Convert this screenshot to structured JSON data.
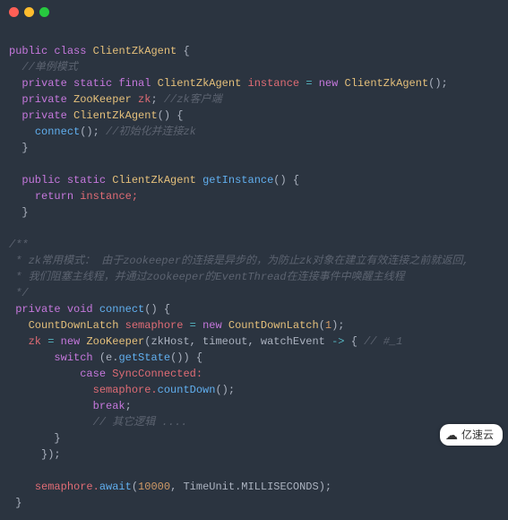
{
  "titlebar": {
    "dots": [
      "red",
      "yellow",
      "green"
    ]
  },
  "watermark": {
    "icon": "☁",
    "label": "亿速云"
  },
  "code": {
    "l1": {
      "a": "public",
      "b": "class",
      "c": "ClientZkAgent",
      "d": "{"
    },
    "l2": {
      "a": "//单例模式"
    },
    "l3": {
      "a": "private",
      "b": "static",
      "c": "final",
      "d": "ClientZkAgent",
      "e": "instance",
      "f": "=",
      "g": "new",
      "h": "ClientZkAgent",
      "i": "();"
    },
    "l4": {
      "a": "private",
      "b": "ZooKeeper",
      "c": "zk",
      "d": ";",
      "e": "//zk客户端"
    },
    "l5": {
      "a": "private",
      "b": "ClientZkAgent",
      "c": "() {"
    },
    "l6": {
      "a": "connect",
      "b": "();",
      "c": "//初始化并连接zk"
    },
    "l7": {
      "a": "}"
    },
    "l9": {
      "a": "public",
      "b": "static",
      "c": "ClientZkAgent",
      "d": "getInstance",
      "e": "() {"
    },
    "l10": {
      "a": "return",
      "b": "instance;"
    },
    "l11": {
      "a": "}"
    },
    "l13": {
      "a": "/**"
    },
    "l14": {
      "a": " * zk常用模式： 由于zookeeper的连接是异步的，为防止zk对象在建立有效连接之前就返回,"
    },
    "l15": {
      "a": " * 我们阻塞主线程，并通过zookeeper的EventThread在连接事件中唤醒主线程"
    },
    "l16": {
      "a": " */"
    },
    "l17": {
      "a": "private",
      "b": "void",
      "c": "connect",
      "d": "() {"
    },
    "l18": {
      "a": "CountDownLatch",
      "b": "semaphore",
      "c": "=",
      "d": "new",
      "e": "CountDownLatch",
      "f": "(",
      "g": "1",
      "h": ");"
    },
    "l19": {
      "a": "zk",
      "b": "=",
      "c": "new",
      "d": "ZooKeeper",
      "e": "(zkHost, timeout, watchEvent",
      "f": "->",
      "g": "{",
      "h": "// #_1"
    },
    "l20": {
      "a": "switch",
      "b": "(e.",
      "c": "getState",
      "d": "()) {"
    },
    "l21": {
      "a": "case",
      "b": "SyncConnected:"
    },
    "l22": {
      "a": "semaphore.",
      "b": "countDown",
      "c": "();"
    },
    "l23": {
      "a": "break",
      "b": ";"
    },
    "l24": {
      "a": "// 其它逻辑 ...."
    },
    "l27": {
      "a": "}"
    },
    "l28": {
      "a": "});"
    },
    "l30": {
      "a": "semaphore.",
      "b": "await",
      "c": "(",
      "d": "10000",
      "e": ", TimeUnit.MILLISECONDS);"
    },
    "l31": {
      "a": "}"
    }
  }
}
